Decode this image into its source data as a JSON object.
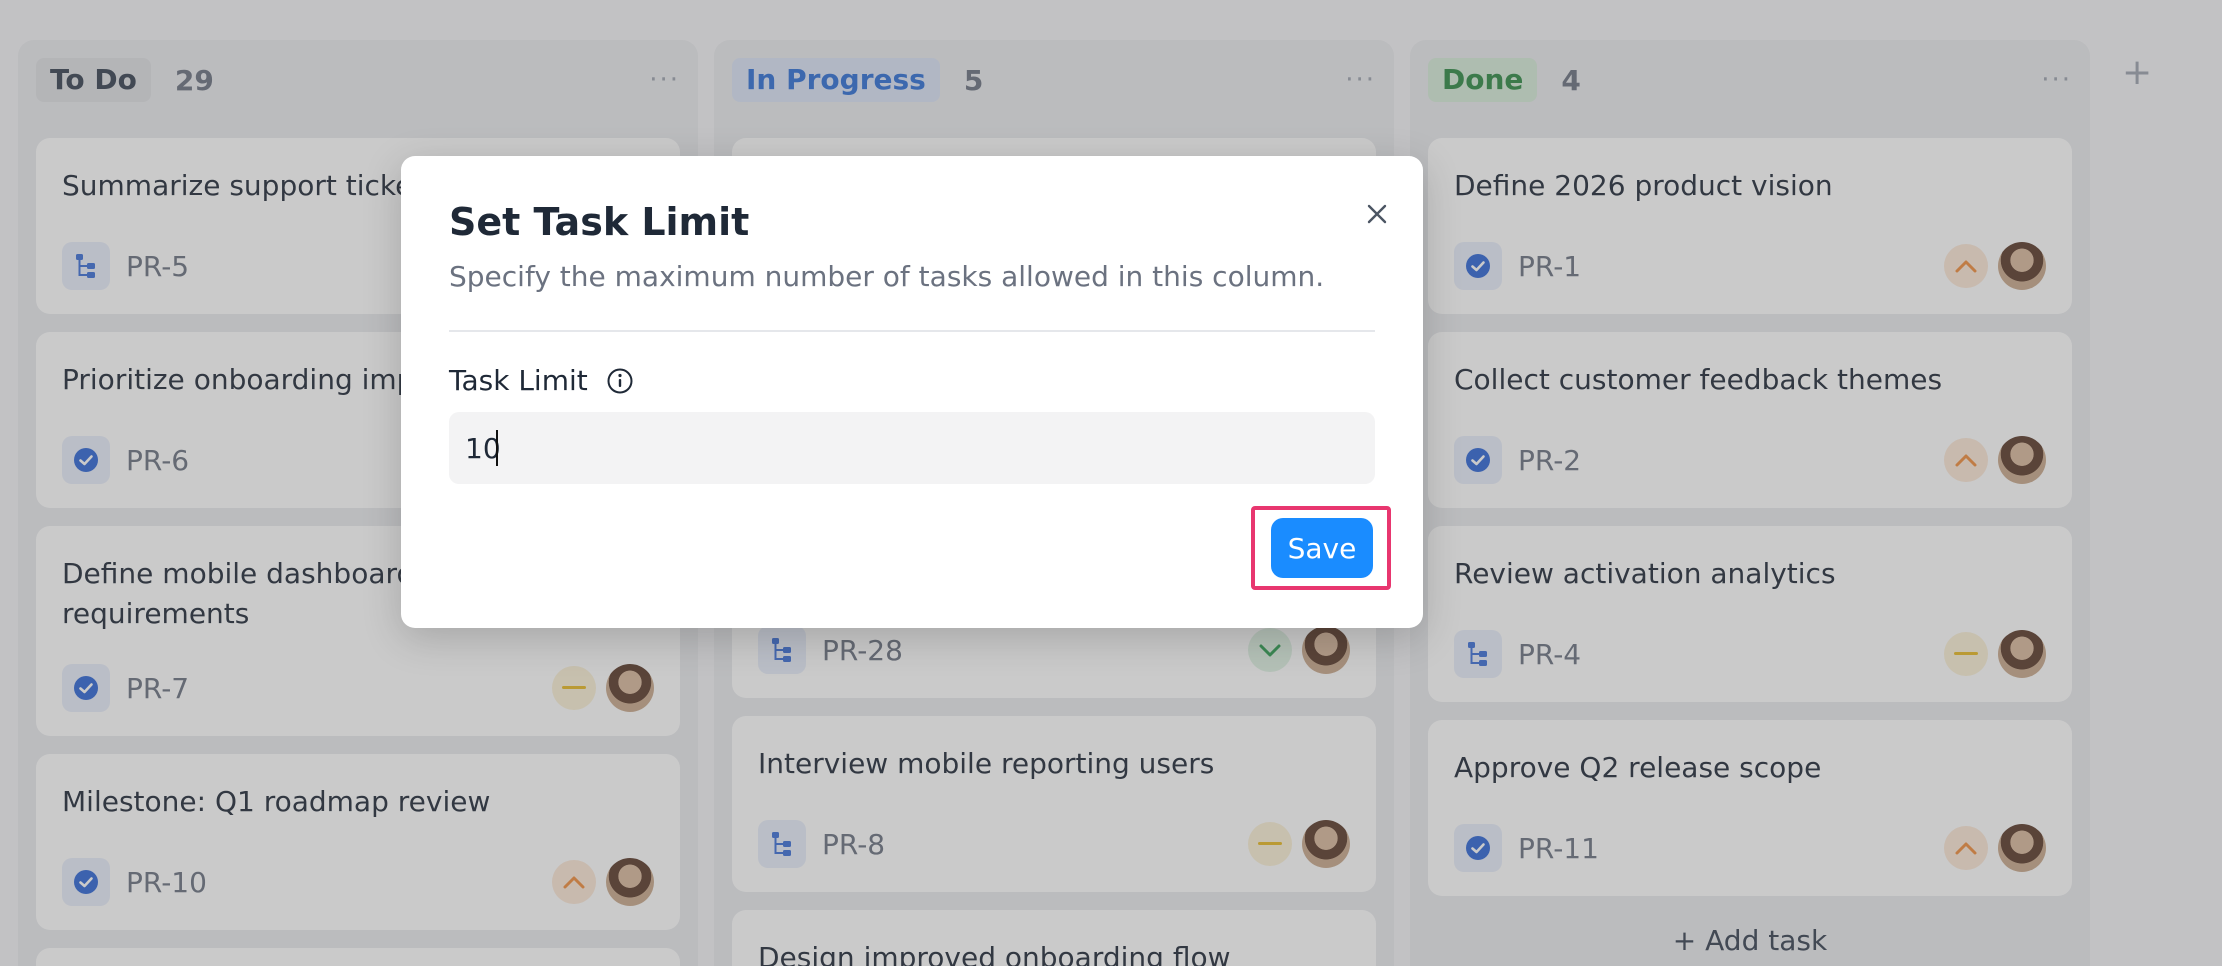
{
  "columns": [
    {
      "name": "To Do",
      "count": "29",
      "more": "···",
      "pill_bg": "#dfe0e4",
      "pill_fg": "#374151",
      "cards": [
        {
          "title": "Summarize support ticket",
          "key": "PR-5",
          "type": "subtask"
        },
        {
          "title": "Prioritize onboarding impr",
          "key": "PR-6",
          "type": "task"
        },
        {
          "title": "Define mobile dashboard\nrequirements",
          "key": "PR-7",
          "type": "task",
          "priority": "medium"
        },
        {
          "title": "Milestone: Q1 roadmap review",
          "key": "PR-10",
          "type": "task",
          "priority": "high"
        }
      ]
    },
    {
      "name": "In Progress",
      "count": "5",
      "more": "···",
      "pill_bg": "#dbe4f7",
      "pill_fg": "#2f6fd6",
      "cards": [
        {
          "title": "",
          "key": "PR-28",
          "type": "subtask",
          "priority": "low"
        },
        {
          "title": "Interview mobile reporting users",
          "key": "PR-8",
          "type": "subtask",
          "priority": "medium"
        },
        {
          "title": "Design improved onboarding flow",
          "key": "",
          "type": ""
        }
      ]
    },
    {
      "name": "Done",
      "count": "4",
      "more": "···",
      "pill_bg": "#d6ecd9",
      "pill_fg": "#2e8a45",
      "cards": [
        {
          "title": "Define 2026 product vision",
          "key": "PR-1",
          "type": "task",
          "priority": "high"
        },
        {
          "title": "Collect customer feedback themes",
          "key": "PR-2",
          "type": "task",
          "priority": "high"
        },
        {
          "title": "Review activation analytics",
          "key": "PR-4",
          "type": "subtask",
          "priority": "medium"
        },
        {
          "title": "Approve Q2 release scope",
          "key": "PR-11",
          "type": "task",
          "priority": "high"
        }
      ],
      "add_task": "+  Add task"
    }
  ],
  "add_column": "+",
  "modal": {
    "title": "Set Task Limit",
    "description": "Specify the maximum number of tasks allowed in this column.",
    "field_label": "Task Limit",
    "field_value": "10",
    "save_label": "Save"
  },
  "colors": {
    "accent": "#1a8cff",
    "highlight": "#e8366f",
    "priority_high": "#f08c3c",
    "priority_medium": "#e8b923",
    "priority_low": "#2e9e52"
  }
}
